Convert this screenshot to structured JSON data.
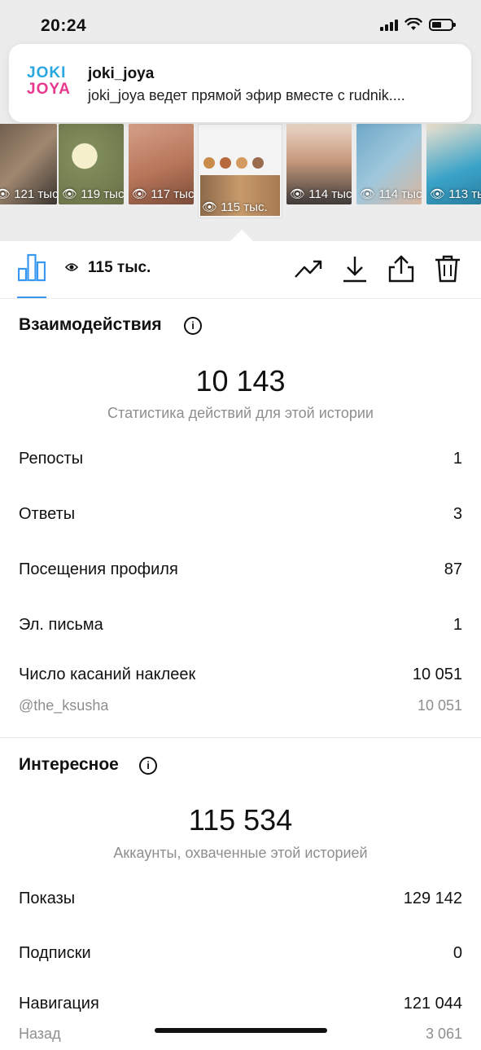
{
  "status_bar": {
    "time": "20:24"
  },
  "notification": {
    "logo_top": "JOKI",
    "logo_bottom": "JOYA",
    "title": "joki_joya",
    "text": "joki_joya ведет прямой эфир вместе с rudnik...."
  },
  "stories": [
    {
      "views": "121 тыс"
    },
    {
      "views": "119 тыс"
    },
    {
      "views": "117 тыс"
    },
    {
      "views": "115 тыс.",
      "selected": true
    },
    {
      "views": "114 тыс"
    },
    {
      "views": "114 тыс"
    },
    {
      "views": "113 тыс"
    }
  ],
  "toolbar": {
    "views_total": "115 тыс."
  },
  "interactions": {
    "title": "Взаимодействия",
    "total": "10 143",
    "caption": "Статистика действий для этой истории",
    "rows": [
      {
        "label": "Репосты",
        "value": "1"
      },
      {
        "label": "Ответы",
        "value": "3"
      },
      {
        "label": "Посещения профиля",
        "value": "87"
      },
      {
        "label": "Эл. письма",
        "value": "1"
      },
      {
        "label": "Число касаний наклеек",
        "value": "10 051"
      }
    ],
    "sub_row": {
      "label": "@the_ksusha",
      "value": "10 051"
    }
  },
  "discovery": {
    "title": "Интересное",
    "total": "115 534",
    "caption": "Аккаунты, охваченные этой историей",
    "rows": [
      {
        "label": "Показы",
        "value": "129 142"
      },
      {
        "label": "Подписки",
        "value": "0"
      },
      {
        "label": "Навигация",
        "value": "121 044"
      }
    ],
    "sub_row": {
      "label": "Назад",
      "value": "3 061"
    }
  }
}
